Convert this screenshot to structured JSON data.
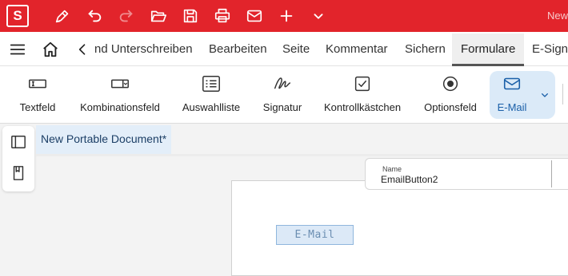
{
  "titlebar": {
    "logo_letter": "S",
    "title": "New",
    "background": "#e2242b",
    "quick_actions": [
      "pen-icon",
      "undo-icon",
      "redo-icon",
      "open-folder-icon",
      "save-icon",
      "print-icon",
      "mail-icon",
      "plus-icon",
      "chevron-down-icon"
    ]
  },
  "menubar": {
    "tabs": [
      {
        "label": "nd Unterschreiben"
      },
      {
        "label": "Bearbeiten"
      },
      {
        "label": "Seite"
      },
      {
        "label": "Kommentar"
      },
      {
        "label": "Sichern"
      },
      {
        "label": "Formulare"
      },
      {
        "label": "E-Sign"
      }
    ],
    "active_tab": "Formulare"
  },
  "ribbon": {
    "buttons": [
      {
        "label": "Textfeld",
        "icon": "textfield-icon"
      },
      {
        "label": "Kombinationsfeld",
        "icon": "combobox-icon"
      },
      {
        "label": "Auswahlliste",
        "icon": "listbox-icon"
      },
      {
        "label": "Signatur",
        "icon": "signature-icon"
      },
      {
        "label": "Kontrollkästchen",
        "icon": "checkbox-icon"
      },
      {
        "label": "Optionsfeld",
        "icon": "radio-icon"
      },
      {
        "label": "E-Mail",
        "icon": "mail-icon"
      }
    ],
    "active": "E-Mail",
    "accent": "#1a5fa8"
  },
  "document": {
    "tab_title": "New Portable Document*"
  },
  "properties": {
    "name_label": "Name",
    "name_value": "EmailButton2"
  },
  "canvas": {
    "field_text": "E-Mail"
  }
}
